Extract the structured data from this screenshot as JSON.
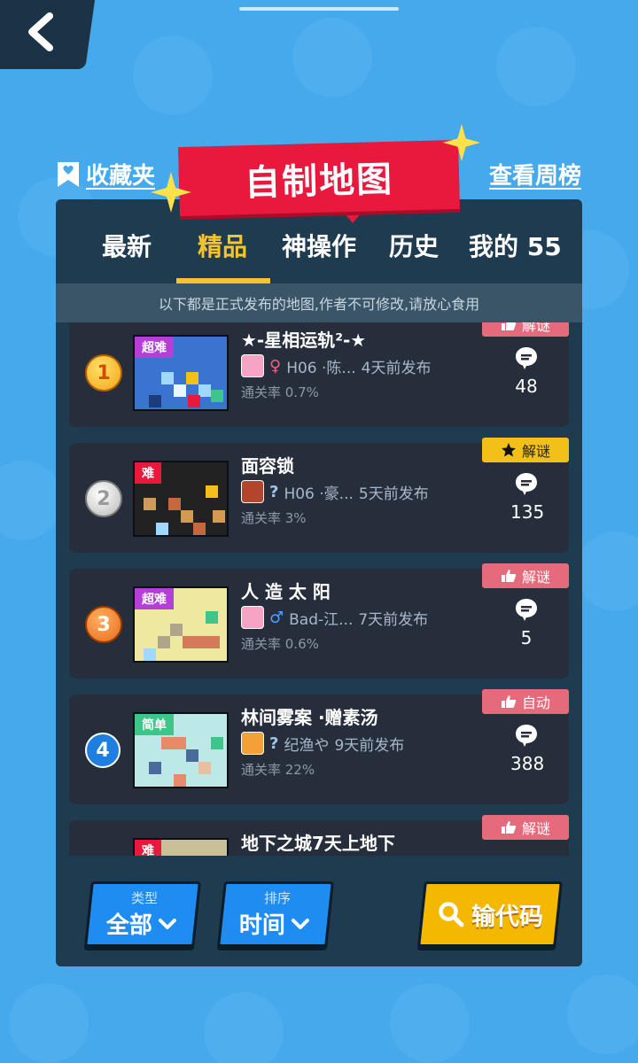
{
  "header": {
    "favorites_label": "收藏夹",
    "title": "自制地图",
    "weekly_label": "查看周榜"
  },
  "tabs": [
    {
      "label": "最新",
      "active": false
    },
    {
      "label": "精品",
      "active": true
    },
    {
      "label": "神操作",
      "active": false
    },
    {
      "label": "历史",
      "active": false
    },
    {
      "label": "我的 55",
      "active": false
    }
  ],
  "notice": "以下都是正式发布的地图,作者不可修改,请放心食用",
  "maps": [
    {
      "rank": "1",
      "difficulty": "超难",
      "difficulty_color": "#b33fd6",
      "title": "★-星相运轨²-★",
      "gender": "♀",
      "gender_color": "#f2607e",
      "author": "H06 ·陈...",
      "published": "4天前发布",
      "clear_rate": "通关率 0.7%",
      "tag": "解谜",
      "tag_style": "red",
      "comments": "48"
    },
    {
      "rank": "2",
      "difficulty": "难",
      "difficulty_color": "#e8193d",
      "title": "面容锁",
      "gender": "?",
      "gender_color": "#9fc4e8",
      "author": "H06 ·豪...",
      "published": "5天前发布",
      "clear_rate": "通关率 3%",
      "tag": "解谜",
      "tag_style": "yellow",
      "comments": "135"
    },
    {
      "rank": "3",
      "difficulty": "超难",
      "difficulty_color": "#b33fd6",
      "title": "人 造 太 阳",
      "gender": "♂",
      "gender_color": "#4aa3ff",
      "author": "Bad-江...",
      "published": "7天前发布",
      "clear_rate": "通关率 0.6%",
      "tag": "解谜",
      "tag_style": "red",
      "comments": "5"
    },
    {
      "rank": "4",
      "difficulty": "简单",
      "difficulty_color": "#3fc48a",
      "title": "林间雾案 ·赠素汤",
      "gender": "?",
      "gender_color": "#9fc4e8",
      "author": "纪渔や",
      "published": "9天前发布",
      "clear_rate": "通关率 22%",
      "tag": "自动",
      "tag_style": "red",
      "comments": "388"
    },
    {
      "rank": "",
      "difficulty": "难",
      "difficulty_color": "#e8193d",
      "title": "地下之城7天上地下",
      "gender": "",
      "gender_color": "#9fc4e8",
      "author": "",
      "published": "",
      "clear_rate": "",
      "tag": "解谜",
      "tag_style": "red",
      "comments": ""
    }
  ],
  "bottom": {
    "type_label": "类型",
    "type_value": "全部",
    "sort_label": "排序",
    "sort_value": "时间",
    "code_label": "输代码"
  },
  "colors": {
    "background": "#45a9ec",
    "panel": "#1f3b4f",
    "accent_yellow": "#f5c431",
    "banner_red": "#e8193d"
  }
}
